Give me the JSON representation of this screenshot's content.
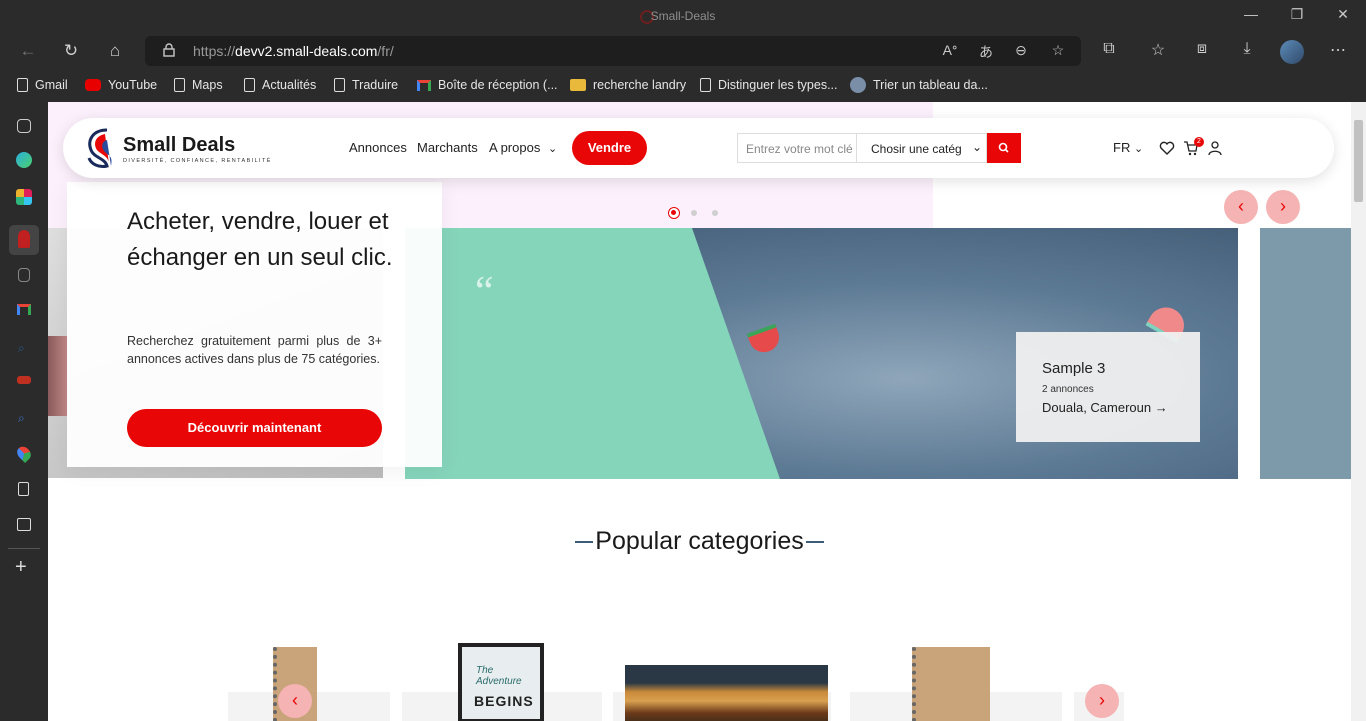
{
  "window": {
    "title": "Small-Deals",
    "controls": [
      "—",
      "❐",
      "✕"
    ]
  },
  "toolbar": {
    "url_prefix": "https://",
    "url_host": "devv2.small-deals.com",
    "url_path": "/fr/"
  },
  "bookmarks": [
    {
      "label": "Gmail",
      "icon": "file-icon"
    },
    {
      "label": "YouTube",
      "icon": "youtube-icon"
    },
    {
      "label": "Maps",
      "icon": "file-icon"
    },
    {
      "label": "Actualités",
      "icon": "file-icon"
    },
    {
      "label": "Traduire",
      "icon": "file-icon"
    },
    {
      "label": "Boîte de réception (...",
      "icon": "gmail-icon"
    },
    {
      "label": "recherche landry",
      "icon": "folder-icon"
    },
    {
      "label": "Distinguer les types...",
      "icon": "file-icon"
    },
    {
      "label": "Trier un tableau da...",
      "icon": "site-icon"
    }
  ],
  "header": {
    "logo_text": "Small Deals",
    "logo_tagline": "DIVERSITÉ, CONFIANCE, RENTABILITÉ",
    "nav": [
      "Annonces",
      "Marchants",
      "A propos"
    ],
    "sell_button": "Vendre",
    "search_placeholder": "Entrez votre mot clé",
    "category_select": "Chosir une catég",
    "language": "FR",
    "cart_count": "2"
  },
  "hero": {
    "title": "Acheter, vendre, louer et échanger en un seul clic.",
    "description": "Recherchez gratuitement parmi plus de 3+ annonces actives dans plus de 75 catégories.",
    "cta": "Découvrir maintenant"
  },
  "slider": {
    "active_index": 0,
    "dots": 3,
    "card": {
      "title": "Sample 3",
      "count": "2 annonces",
      "location": "Douala, Cameroun"
    }
  },
  "popular": {
    "title": "Popular categories",
    "frame_line1": "The Adventure",
    "frame_line2": "BEGINS"
  },
  "colors": {
    "brand_red": "#e80606",
    "mint": "#85d5bb",
    "navy": "#3b5d79"
  }
}
